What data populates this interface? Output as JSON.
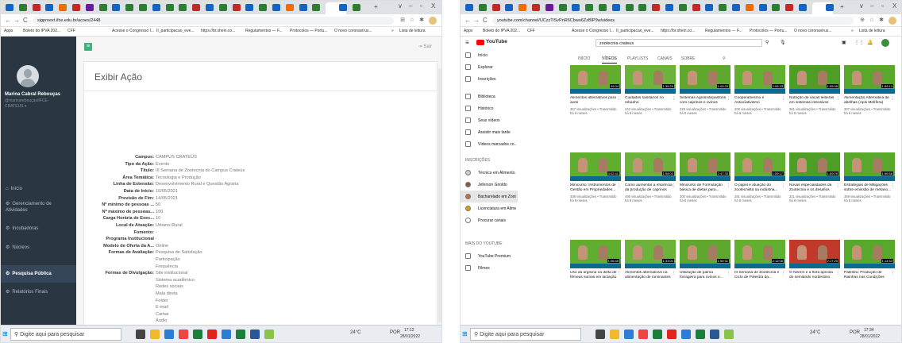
{
  "common": {
    "tab_add": "+",
    "win_min": "∨",
    "win_dash": "–",
    "win_box": "▫",
    "win_close": "X",
    "nav_back": "←",
    "nav_fwd": "→",
    "nav_reload": "C",
    "bookmarks": [
      "Apps",
      "Boleto do IPVA 202...",
      "CFF",
      "Acesse o Congresso I...",
      "II_participacao_eve...",
      "https://br.shein.co...",
      "Regulamentos — F...",
      "Protocolos — Portu...",
      "O novo coronavirus..."
    ],
    "bookmarks_more": "»",
    "reading_list": "Lista de leitura",
    "taskbar_search": "Digite aqui para pesquisar",
    "weather": "24°C",
    "lang": "POR"
  },
  "shot1": {
    "url": "sigproext.ifce.edu.br/acoes/2448",
    "time": "17:12",
    "date": "28/01/2022",
    "user_name": "Marina Cabral Rebouças",
    "user_email": "@marinarebouças/IFCE-",
    "user_campus": "CRATEUS ▾",
    "menu": [
      "Início",
      "Gerenciamento de Atividades",
      "Incubadoras",
      "Núcleos",
      "Pesquisa Pública",
      "Relatórios Finais"
    ],
    "menu_btn": "≡",
    "sair": "Sair",
    "page_title": "Exibir Ação",
    "fields": [
      {
        "label": "Campus:",
        "value": "CAMPUS CRATEÚS"
      },
      {
        "label": "Tipo da Ação:",
        "value": "Evento"
      },
      {
        "label": "Título:",
        "value": "III Semana de Zootecnia do Campus Crateús"
      },
      {
        "label": "Área Temática:",
        "value": "Tecnologia e Produção"
      },
      {
        "label": "Linha de Extensão:",
        "value": "Desenvolvimento Rural e Questão Agrária"
      },
      {
        "label": "Data de Início:",
        "value": "10/05/2021"
      },
      {
        "label": "Previsão de Fim:",
        "value": "14/05/2021"
      },
      {
        "label": "Nº mínimo de pessoas ...",
        "value": "50"
      },
      {
        "label": "Nº máximo de pessoas...",
        "value": "100"
      },
      {
        "label": "Carga Horária de Exec...",
        "value": "10"
      },
      {
        "label": "Local de Atuação:",
        "value": "Urbano-Rural"
      },
      {
        "label": "Fomento:",
        "value": "-"
      },
      {
        "label": "Programa Institucional",
        "value": "-"
      },
      {
        "label": "Modelo de Oferta da A...",
        "value": "Online"
      },
      {
        "label": "Formas de Avaliação:",
        "value": "Pesquisa de Satisfação"
      },
      {
        "label": "",
        "value": "Participação"
      },
      {
        "label": "",
        "value": "Frequência"
      },
      {
        "label": "Formas de Divulgação:",
        "value": "Site institucional"
      },
      {
        "label": "",
        "value": "Sistema acadêmico"
      },
      {
        "label": "",
        "value": "Redes sociais"
      },
      {
        "label": "",
        "value": "Mala direta"
      },
      {
        "label": "",
        "value": "Folder"
      },
      {
        "label": "",
        "value": "E-mail"
      },
      {
        "label": "",
        "value": "Cartas"
      },
      {
        "label": "",
        "value": "Áudio"
      }
    ]
  },
  "shot2": {
    "url": "youtube.com/channel/UCzzTiSvPnR6Cbwo6ZzBlP9w/videos",
    "time": "17:34",
    "date": "28/01/2022",
    "logo": "YouTube",
    "search_value": "zootecnia crateus",
    "sidebar": [
      "Início",
      "Explorar",
      "Inscrições",
      "Biblioteca",
      "Histórico",
      "Seus vídeos",
      "Assistir mais tarde",
      "Vídeos marcados co..."
    ],
    "subs_head": "INSCRIÇÕES",
    "subs": [
      "Técnico em Alimento...",
      "Jeferson Gnoldo",
      "Bacharelado em Zoot...",
      "Licenciatura em Aliment...",
      "Procurar canais"
    ],
    "more_head": "MAIS DO YOUTUBE",
    "more": [
      "YouTube Premium",
      "Filmes"
    ],
    "channel_tabs": [
      "INÍCIO",
      "VÍDEOS",
      "PLAYLISTS",
      "CANAIS",
      "SOBRE"
    ],
    "videos": [
      {
        "title": "Alimentos alternativos para aves",
        "meta": "357 visualizações • Transmitido há 9 meses",
        "dur": "49:34"
      },
      {
        "title": "Cuidados sanitários no rebanho",
        "meta": "242 visualizações • Transmitido há 8 meses",
        "dur": "1:35:29"
      },
      {
        "title": "Sistemas Agrossilvipastoris com caprinos e ovinos",
        "meta": "229 visualizações • Transmitido há 8 meses",
        "dur": "1:00:29"
      },
      {
        "title": "Cooperativismo e Associativismo",
        "meta": "206 visualizações • Transmitido há 8 meses",
        "dur": "2:06:33"
      },
      {
        "title": "Nutrição de vacas leiteiras em sistemas intensivos",
        "meta": "361 visualizações • Transmitido há 8 meses",
        "dur": "1:55:08"
      },
      {
        "title": "Alimentação Alternativa de abelhas (Apis Melífera)",
        "meta": "307 visualizações • Transmitido há 8 meses",
        "dur": "1:59:13"
      },
      {
        "title": "Minicurso: Instrumentos de Gestão em Propriedades...",
        "meta": "308 visualizações • Transmitido há 8 meses",
        "dur": "3:02:41"
      },
      {
        "title": "Como aumentar a eficiência da produção de caprinos e...",
        "meta": "495 visualizações • Transmitido há 8 meses",
        "dur": "1:58:03"
      },
      {
        "title": "Minicurso de Formulação básica de dietas para...",
        "meta": "300 visualizações • Transmitido há 8 meses",
        "dur": "2:47:30"
      },
      {
        "title": "O papel e atuação do zootecnista na indústria...",
        "meta": "281 visualizações • Transmitido há 8 meses",
        "dur": "1:59:17"
      },
      {
        "title": "Novas especialidades da Zootecnia e os desafios da...",
        "meta": "321 visualizações • Transmitido há 8 meses",
        "dur": "1:59:29"
      },
      {
        "title": "Estratégias de Mitigações sobre emissão de metano...",
        "meta": "359 visualizações • Transmitido há 8 meses",
        "dur": "1:56:58"
      },
      {
        "title": "Uso da argisina na dieta de fêmeas suínas em lactação",
        "meta": "",
        "dur": "1:06:46"
      },
      {
        "title": "Alimentos alternativos na alimentação de ruminantes",
        "meta": "",
        "dur": "1:33:04"
      },
      {
        "title": "Utilização de palma forrageira para ovinos e...",
        "meta": "",
        "dur": "1:59:31"
      },
      {
        "title": "III Semana de Zootecnia e Ciclo de Palestra da...",
        "meta": "",
        "dur": "2:12:06"
      },
      {
        "title": "O Nerem e a flora apícola do semiárido nordestino dando...",
        "meta": "",
        "dur": "2:17:20"
      },
      {
        "title": "Palestra: Produção de Rainhas nas Condições do...",
        "meta": "",
        "dur": "1:14:53"
      }
    ]
  }
}
